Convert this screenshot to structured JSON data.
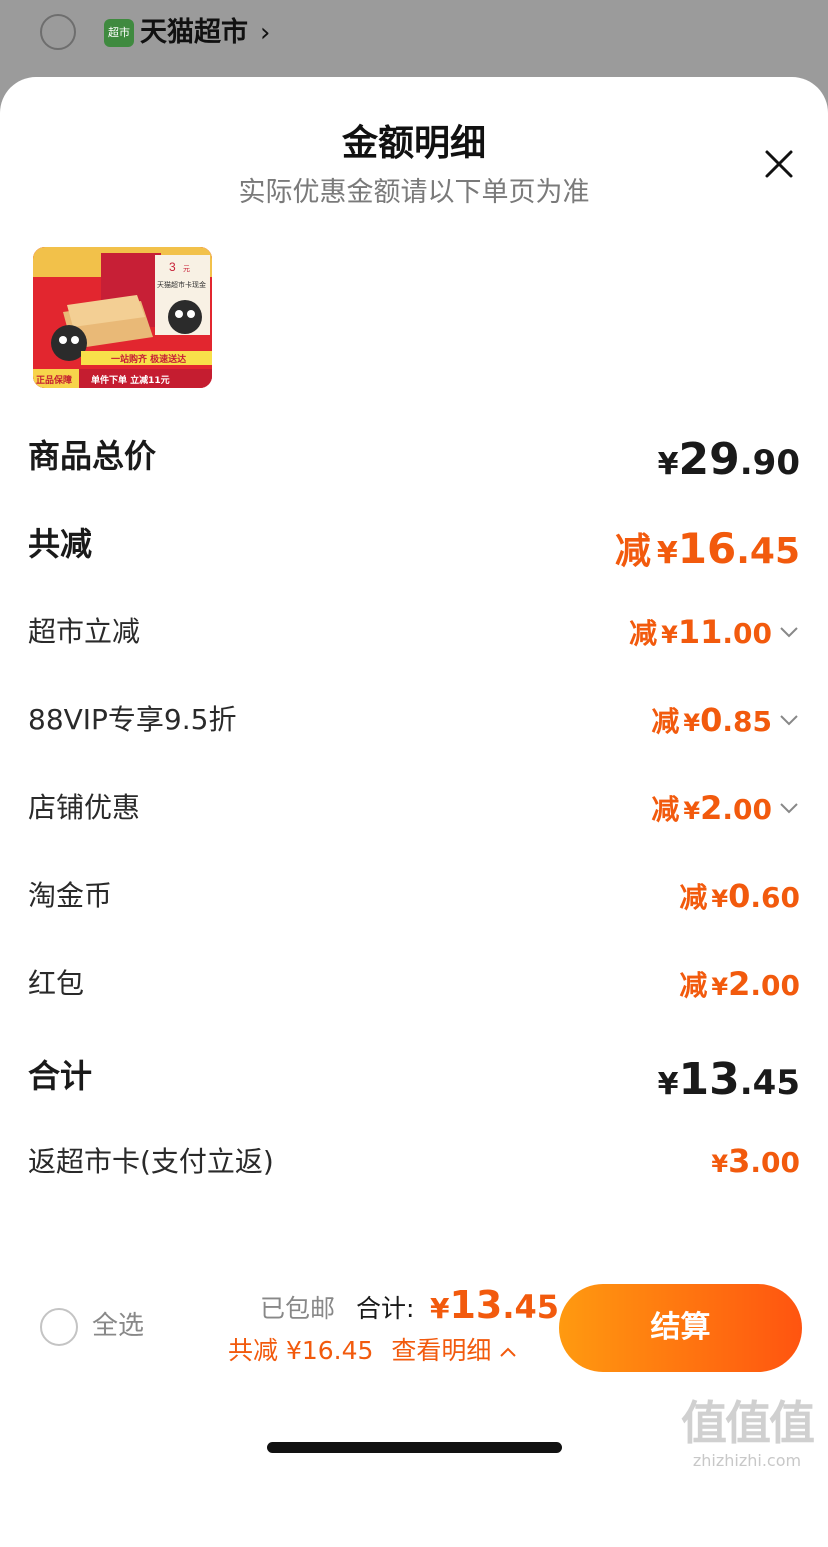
{
  "store": {
    "logo_text": "超市",
    "name": "天猫超市",
    "chevron": "›"
  },
  "sheet": {
    "title": "金额明细",
    "subtitle": "实际优惠金额请以下单页为准"
  },
  "product": {
    "badge_authentic": "正品保障",
    "banner_text": "一站购齐 极速送达",
    "promo_text": "单件下单 立减11元",
    "coupon_title": "天猫超市卡现金",
    "coupon_amount": "3",
    "coupon_unit": "元"
  },
  "rows": {
    "goods_total": {
      "label": "商品总价",
      "currency": "¥",
      "int": "29",
      "dec": ".90"
    },
    "total_reduce": {
      "label": "共减",
      "prefix": "减",
      "currency": "¥",
      "int": "16",
      "dec": ".45"
    },
    "supermarket_off": {
      "label": "超市立减",
      "prefix": "减",
      "currency": "¥",
      "int": "11",
      "dec": ".00"
    },
    "vip_discount": {
      "label": "88VIP专享9.5折",
      "prefix": "减",
      "currency": "¥",
      "int": "0",
      "dec": ".85"
    },
    "store_discount": {
      "label": "店铺优惠",
      "prefix": "减",
      "currency": "¥",
      "int": "2",
      "dec": ".00"
    },
    "gold_coin": {
      "label": "淘金币",
      "prefix": "减",
      "currency": "¥",
      "int": "0",
      "dec": ".60"
    },
    "red_packet": {
      "label": "红包",
      "prefix": "减",
      "currency": "¥",
      "int": "2",
      "dec": ".00"
    },
    "subtotal": {
      "label": "合计",
      "currency": "¥",
      "int": "13",
      "dec": ".45"
    },
    "cashback": {
      "label": "返超市卡(支付立返)",
      "currency": "¥",
      "int": "3",
      "dec": ".00"
    }
  },
  "bottom_bar": {
    "select_all": "全选",
    "shipping": "已包邮",
    "total_label": "合计:",
    "total_currency": "¥",
    "total_int": "13",
    "total_dec": ".45",
    "saving_text": "共减 ¥16.45",
    "details_link": "查看明细",
    "checkout_button": "结算"
  },
  "watermark": {
    "main": "值值值",
    "sub": "zhizhizhi.com"
  },
  "colors": {
    "accent_orange": "#f25a0d",
    "button_gradient_start": "#ff9a10",
    "button_gradient_end": "#ff5410",
    "overlay_gray": "#9b9b9b"
  }
}
